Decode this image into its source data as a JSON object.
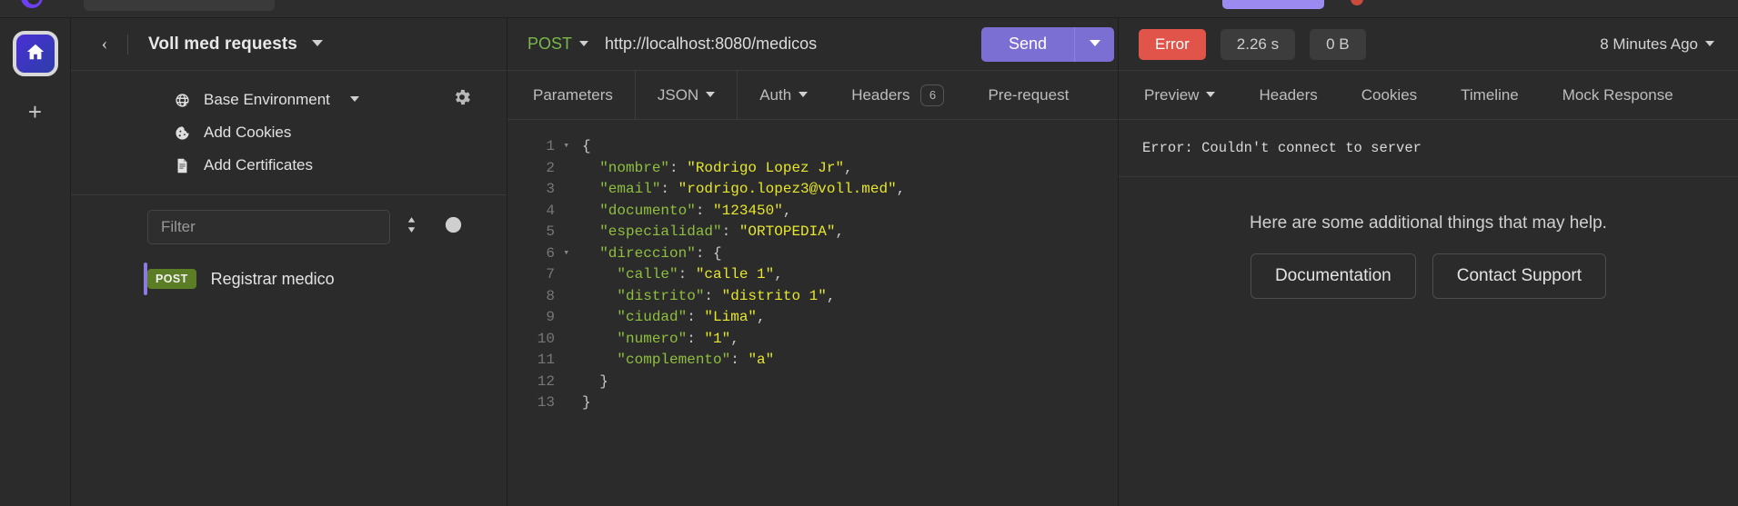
{
  "app": {
    "rail": {
      "home_icon": "home-icon",
      "add_icon": "plus-icon"
    }
  },
  "sidebar": {
    "back_icon": "chevron-left-icon",
    "workspace_title": "Voll med requests",
    "meta_items": [
      {
        "icon": "globe-icon",
        "label": "Base Environment",
        "has_caret": true
      },
      {
        "icon": "cookie-icon",
        "label": "Add Cookies",
        "has_caret": false
      },
      {
        "icon": "certificate-icon",
        "label": "Add Certificates",
        "has_caret": false
      }
    ],
    "settings_icon": "gear-icon",
    "filter": {
      "placeholder": "Filter",
      "value": ""
    },
    "sort_icon": "sort-icon",
    "add_icon": "plus-circle-icon",
    "requests": [
      {
        "method": "POST",
        "name": "Registrar medico",
        "selected": true
      }
    ]
  },
  "request": {
    "method": "POST",
    "url": "http://localhost:8080/medicos",
    "send_label": "Send",
    "send_caret_icon": "chevron-down-icon",
    "tabs": [
      {
        "label": "Parameters",
        "caret": false,
        "count": null
      },
      {
        "label": "JSON",
        "caret": true,
        "count": null
      },
      {
        "label": "Auth",
        "caret": true,
        "count": null
      },
      {
        "label": "Headers",
        "caret": false,
        "count": "6"
      },
      {
        "label": "Pre-request",
        "caret": false,
        "count": null
      }
    ],
    "editor": {
      "line_numbers": [
        "1",
        "2",
        "3",
        "4",
        "5",
        "6",
        "7",
        "8",
        "9",
        "10",
        "11",
        "12",
        "13"
      ],
      "fold_lines": [
        1,
        6
      ],
      "lines": [
        [
          {
            "t": "{",
            "c": "p"
          }
        ],
        [
          {
            "t": "  ",
            "c": "p"
          },
          {
            "t": "\"nombre\"",
            "c": "k"
          },
          {
            "t": ": ",
            "c": "p"
          },
          {
            "t": "\"Rodrigo Lopez Jr\"",
            "c": "s"
          },
          {
            "t": ",",
            "c": "p"
          }
        ],
        [
          {
            "t": "  ",
            "c": "p"
          },
          {
            "t": "\"email\"",
            "c": "k"
          },
          {
            "t": ": ",
            "c": "p"
          },
          {
            "t": "\"rodrigo.lopez3@voll.med\"",
            "c": "s"
          },
          {
            "t": ",",
            "c": "p"
          }
        ],
        [
          {
            "t": "  ",
            "c": "p"
          },
          {
            "t": "\"documento\"",
            "c": "k"
          },
          {
            "t": ": ",
            "c": "p"
          },
          {
            "t": "\"123450\"",
            "c": "s"
          },
          {
            "t": ",",
            "c": "p"
          }
        ],
        [
          {
            "t": "  ",
            "c": "p"
          },
          {
            "t": "\"especialidad\"",
            "c": "k"
          },
          {
            "t": ": ",
            "c": "p"
          },
          {
            "t": "\"ORTOPEDIA\"",
            "c": "s"
          },
          {
            "t": ",",
            "c": "p"
          }
        ],
        [
          {
            "t": "  ",
            "c": "p"
          },
          {
            "t": "\"direccion\"",
            "c": "k"
          },
          {
            "t": ": ",
            "c": "p"
          },
          {
            "t": "{",
            "c": "p"
          }
        ],
        [
          {
            "t": "    ",
            "c": "p"
          },
          {
            "t": "\"calle\"",
            "c": "k"
          },
          {
            "t": ": ",
            "c": "p"
          },
          {
            "t": "\"calle 1\"",
            "c": "s"
          },
          {
            "t": ",",
            "c": "p"
          }
        ],
        [
          {
            "t": "    ",
            "c": "p"
          },
          {
            "t": "\"distrito\"",
            "c": "k"
          },
          {
            "t": ": ",
            "c": "p"
          },
          {
            "t": "\"distrito 1\"",
            "c": "s"
          },
          {
            "t": ",",
            "c": "p"
          }
        ],
        [
          {
            "t": "    ",
            "c": "p"
          },
          {
            "t": "\"ciudad\"",
            "c": "k"
          },
          {
            "t": ": ",
            "c": "p"
          },
          {
            "t": "\"Lima\"",
            "c": "s"
          },
          {
            "t": ",",
            "c": "p"
          }
        ],
        [
          {
            "t": "    ",
            "c": "p"
          },
          {
            "t": "\"numero\"",
            "c": "k"
          },
          {
            "t": ": ",
            "c": "p"
          },
          {
            "t": "\"1\"",
            "c": "s"
          },
          {
            "t": ",",
            "c": "p"
          }
        ],
        [
          {
            "t": "    ",
            "c": "p"
          },
          {
            "t": "\"complemento\"",
            "c": "k"
          },
          {
            "t": ": ",
            "c": "p"
          },
          {
            "t": "\"a\"",
            "c": "s"
          }
        ],
        [
          {
            "t": "  ",
            "c": "p"
          },
          {
            "t": "}",
            "c": "p"
          }
        ],
        [
          {
            "t": "}",
            "c": "p"
          }
        ]
      ]
    }
  },
  "response": {
    "status_label": "Error",
    "time_label": "2.26 s",
    "size_label": "0 B",
    "timestamp_label": "8 Minutes Ago",
    "timestamp_caret_icon": "chevron-down-icon",
    "tabs": [
      {
        "label": "Preview",
        "caret": true
      },
      {
        "label": "Headers",
        "caret": false
      },
      {
        "label": "Cookies",
        "caret": false
      },
      {
        "label": "Timeline",
        "caret": false
      },
      {
        "label": "Mock Response",
        "caret": false
      }
    ],
    "error_text": "Error: Couldn't connect to server",
    "help_text": "Here are some additional things that may help.",
    "help_buttons": [
      "Documentation",
      "Contact Support"
    ]
  },
  "colors": {
    "accent_purple": "#7b6fd4",
    "error_red": "#e0544a",
    "method_post_green": "#5a7d26",
    "method_text_green": "#79b84a",
    "json_key": "#8fbf3f",
    "json_string": "#e6e62e",
    "bg": "#2b2b2b"
  }
}
